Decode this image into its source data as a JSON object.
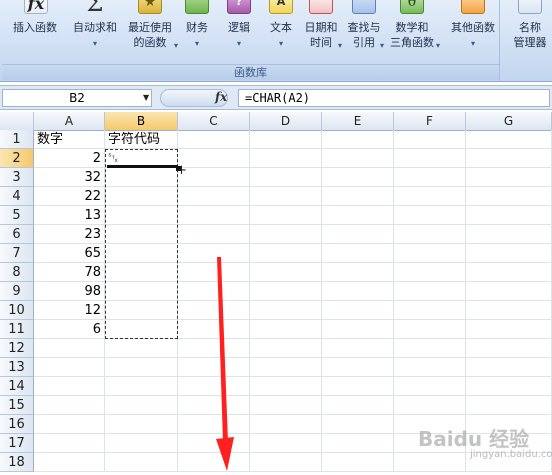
{
  "ribbon": {
    "group_label": "函数库",
    "buttons": [
      {
        "id": "insert-function",
        "label": "插入函数",
        "icon": "fx-icon",
        "icon_glyph": "fx",
        "dropdown": false
      },
      {
        "id": "autosum",
        "label": "自动求和",
        "icon": "sigma-icon",
        "icon_glyph": "Σ",
        "dropdown": true
      },
      {
        "id": "recent",
        "label": "最近使用\n的函数",
        "icon": "star-icon",
        "icon_glyph": "★",
        "dropdown": true
      },
      {
        "id": "finance",
        "label": "财务",
        "icon": "money-icon",
        "icon_glyph": "",
        "dropdown": true
      },
      {
        "id": "logic",
        "label": "逻辑",
        "icon": "logic-icon",
        "icon_glyph": "?",
        "dropdown": true
      },
      {
        "id": "text",
        "label": "文本",
        "icon": "text-icon",
        "icon_glyph": "A",
        "dropdown": true
      },
      {
        "id": "datetime",
        "label": "日期和\n时间",
        "icon": "calendar-icon",
        "icon_glyph": "",
        "dropdown": true
      },
      {
        "id": "lookup",
        "label": "查找与\n引用",
        "icon": "magnifier-icon",
        "icon_glyph": "",
        "dropdown": true
      },
      {
        "id": "math",
        "label": "数学和\n三角函数",
        "icon": "theta-icon",
        "icon_glyph": "θ",
        "dropdown": true
      },
      {
        "id": "other",
        "label": "其他函数",
        "icon": "more-functions-icon",
        "icon_glyph": "",
        "dropdown": true
      }
    ],
    "name_manager": {
      "label": "名称\n管理器",
      "icon": "name-manager-icon"
    }
  },
  "formula_bar": {
    "name_box": "B2",
    "fx_label": "fx",
    "formula": "=CHAR(A2)"
  },
  "grid": {
    "columns": [
      "A",
      "B",
      "C",
      "D",
      "E",
      "F",
      "G"
    ],
    "selected_column": "B",
    "selected_row": 2,
    "rows": [
      {
        "n": "1",
        "A": "数字",
        "B": "字符代码"
      },
      {
        "n": "2",
        "A": "2",
        "B": "␂"
      },
      {
        "n": "3",
        "A": "32",
        "B": ""
      },
      {
        "n": "4",
        "A": "22",
        "B": ""
      },
      {
        "n": "5",
        "A": "13",
        "B": ""
      },
      {
        "n": "6",
        "A": "23",
        "B": ""
      },
      {
        "n": "7",
        "A": "65",
        "B": ""
      },
      {
        "n": "8",
        "A": "78",
        "B": ""
      },
      {
        "n": "9",
        "A": "98",
        "B": ""
      },
      {
        "n": "10",
        "A": "12",
        "B": ""
      },
      {
        "n": "11",
        "A": "6",
        "B": ""
      },
      {
        "n": "12",
        "A": "",
        "B": ""
      },
      {
        "n": "13",
        "A": "",
        "B": ""
      },
      {
        "n": "14",
        "A": "",
        "B": ""
      },
      {
        "n": "15",
        "A": "",
        "B": ""
      },
      {
        "n": "16",
        "A": "",
        "B": ""
      },
      {
        "n": "17",
        "A": "",
        "B": ""
      },
      {
        "n": "18",
        "A": "",
        "B": ""
      }
    ]
  },
  "annotation": {
    "arrow_color": "#ff2020"
  },
  "watermark": {
    "text": "Baidu 经验",
    "sub": "jingyan.baidu.com"
  }
}
